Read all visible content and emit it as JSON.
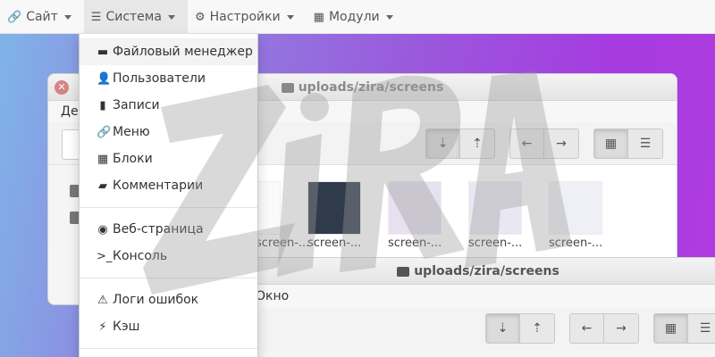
{
  "navbar": {
    "items": [
      {
        "label": "Сайт",
        "icon": "link-icon"
      },
      {
        "label": "Система",
        "icon": "server-icon"
      },
      {
        "label": "Настройки",
        "icon": "gear-icon"
      },
      {
        "label": "Модули",
        "icon": "grid-icon"
      }
    ]
  },
  "dropdown": {
    "items": [
      {
        "label": "Файловый менеджер",
        "icon": "hdd-icon"
      },
      {
        "label": "Пользователи",
        "icon": "user-icon"
      },
      {
        "label": "Записи",
        "icon": "book-icon"
      },
      {
        "label": "Меню",
        "icon": "link-icon"
      },
      {
        "label": "Блоки",
        "icon": "grid-icon"
      },
      {
        "label": "Комментарии",
        "icon": "comment-icon"
      },
      {
        "label": "Веб-страница",
        "icon": "globe-icon"
      },
      {
        "label": "Консоль",
        "icon": "terminal-icon"
      },
      {
        "label": "Логи ошибок",
        "icon": "warning-icon"
      },
      {
        "label": "Кэш",
        "icon": "bolt-icon"
      }
    ]
  },
  "window1": {
    "title": "uploads/zira/screens",
    "menu_partial": "Де",
    "files": [
      "screen-...",
      "screen-...",
      "screen-...",
      "screen-...",
      "screen-..."
    ]
  },
  "window2": {
    "title": "uploads/zira/screens",
    "menu_item": "Окно"
  },
  "watermark": {
    "text": "ZiRA"
  },
  "colors": {
    "accent": "#9a58dc",
    "navbar_bg": "#f8f8f8"
  }
}
